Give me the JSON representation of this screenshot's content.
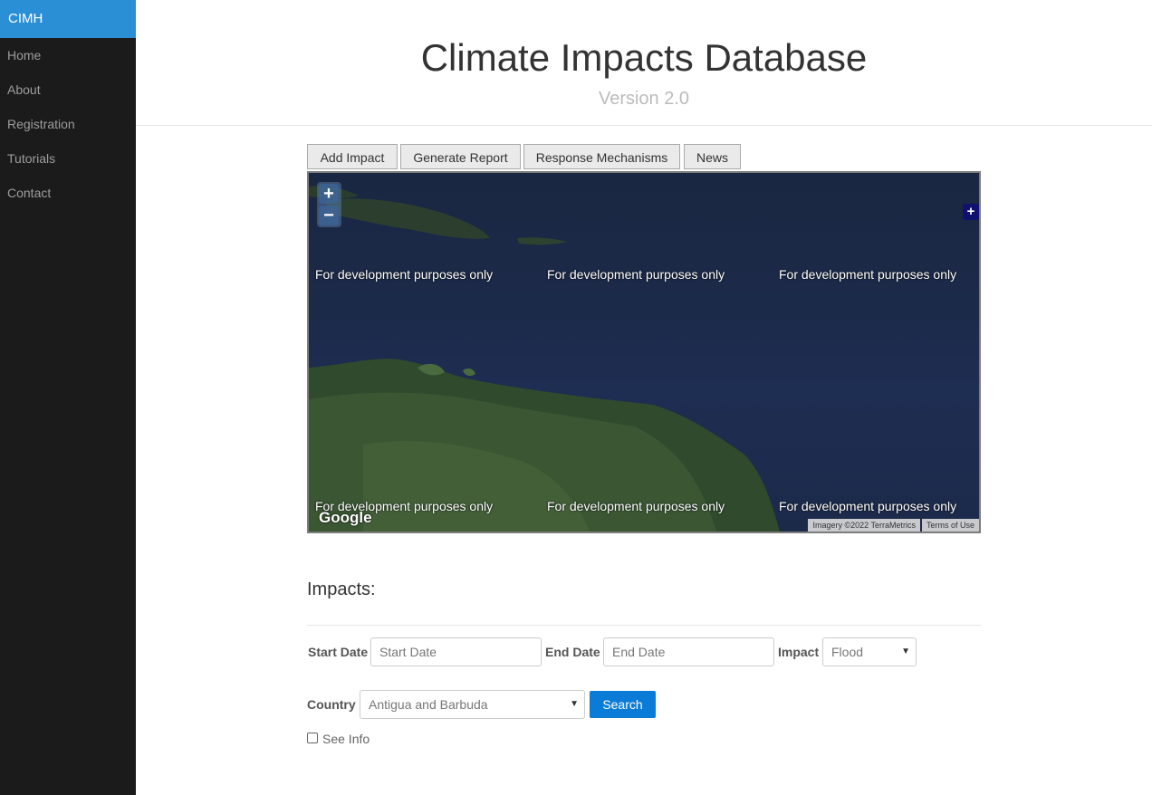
{
  "sidebar": {
    "brand": "CIMH",
    "items": [
      {
        "label": "Home"
      },
      {
        "label": "About"
      },
      {
        "label": "Registration"
      },
      {
        "label": "Tutorials"
      },
      {
        "label": "Contact"
      }
    ]
  },
  "header": {
    "title": "Climate Impacts Database",
    "subtitle": "Version 2.0"
  },
  "tabs": [
    {
      "label": "Add Impact"
    },
    {
      "label": "Generate Report"
    },
    {
      "label": "Response Mechanisms"
    },
    {
      "label": "News"
    }
  ],
  "map": {
    "zoom_in": "+",
    "zoom_out": "−",
    "corner_control": "+",
    "watermark": "For development purposes only",
    "logo": "Google",
    "imagery_credit": "Imagery ©2022 TerraMetrics",
    "terms": "Terms of Use"
  },
  "impacts": {
    "section_title": "Impacts:",
    "start_date_label": "Start Date",
    "start_date_placeholder": "Start Date",
    "end_date_label": "End Date",
    "end_date_placeholder": "End Date",
    "impact_label": "Impact",
    "impact_value": "Flood",
    "country_label": "Country",
    "country_value": "Antigua and Barbuda",
    "search_label": "Search",
    "see_info_label": "See Info"
  },
  "colors": {
    "brand_bg": "#2b8fd6",
    "sidebar_bg": "#1b1b1b",
    "search_bg": "#0a7bd6"
  }
}
